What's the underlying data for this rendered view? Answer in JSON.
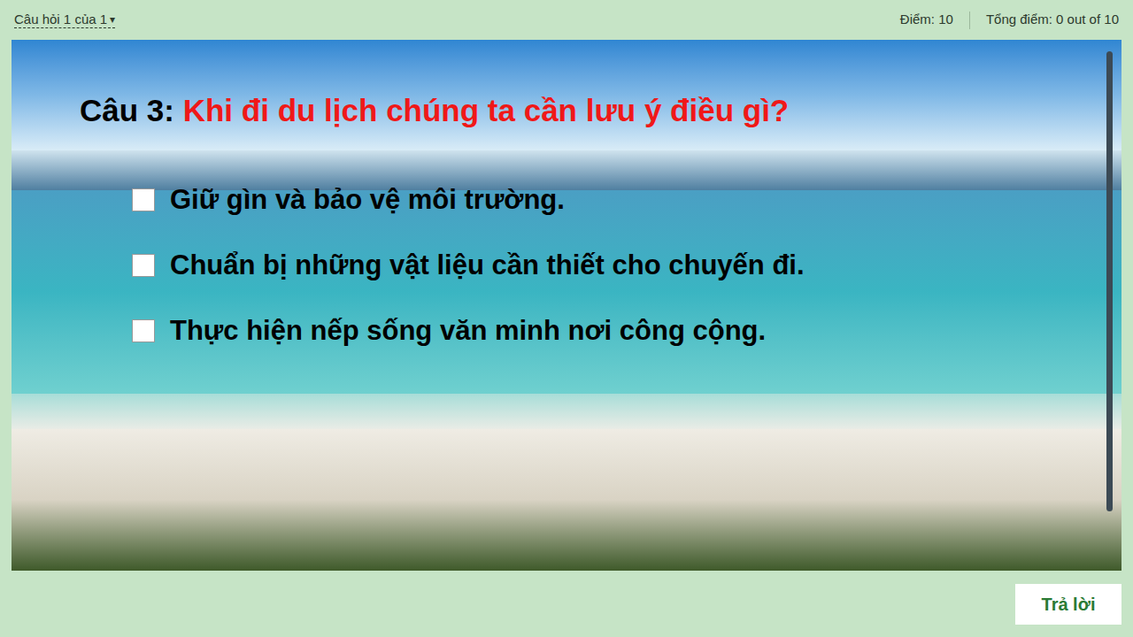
{
  "header": {
    "question_nav": "Câu hỏi 1 của 1",
    "nav_caret": "▾",
    "score": "Điểm: 10",
    "total": "Tổng điểm: 0 out of 10"
  },
  "question": {
    "label": "Câu 3:",
    "text": "Khi đi du lịch chúng ta cần lưu ý điều gì?"
  },
  "options": [
    {
      "text": "Giữ gìn và bảo vệ môi trường.",
      "checked": false
    },
    {
      "text": "Chuẩn bị những vật liệu cần thiết cho chuyến đi.",
      "checked": false
    },
    {
      "text": "Thực hiện nếp sống văn minh nơi công cộng.",
      "checked": false
    }
  ],
  "buttons": [
    "Trả lời"
  ]
}
